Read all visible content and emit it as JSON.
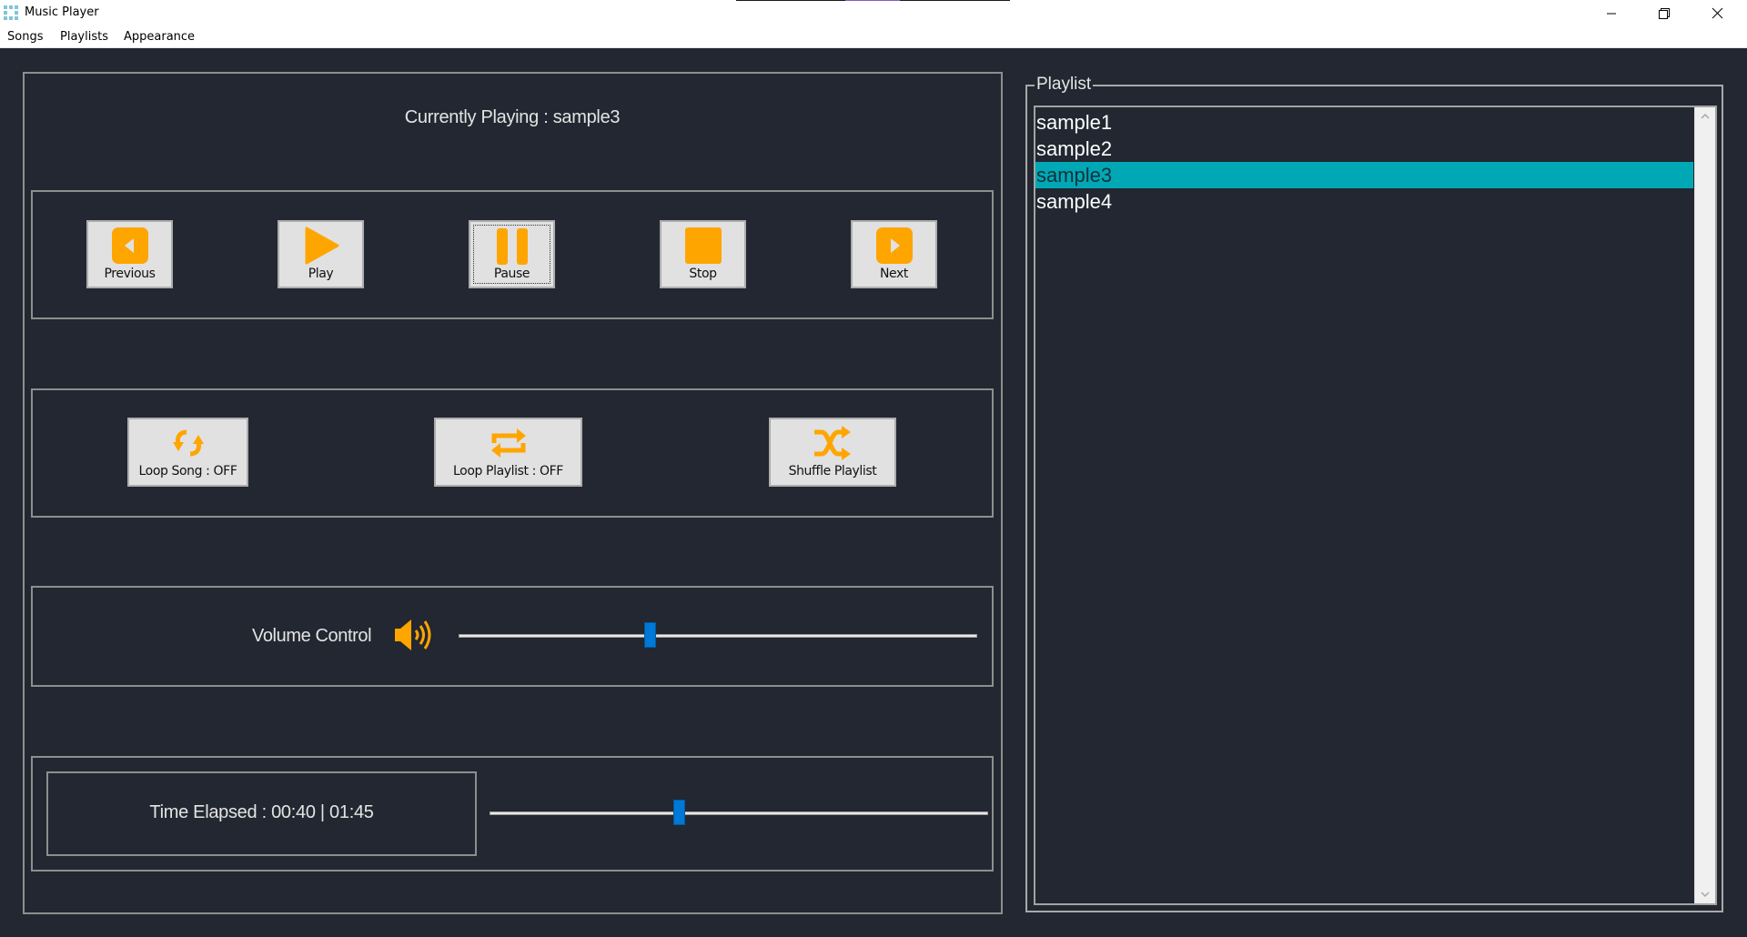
{
  "window": {
    "title": "Music Player",
    "icon": "app-grid-icon",
    "controls": [
      "minimize-icon",
      "restore-icon",
      "close-icon"
    ]
  },
  "menu": {
    "items": [
      "Songs",
      "Playlists",
      "Appearance"
    ]
  },
  "now_playing": {
    "text": "Currently Playing : sample3",
    "song": "sample3"
  },
  "controls": {
    "previous": {
      "label": "Previous",
      "icon": "previous-icon"
    },
    "play": {
      "label": "Play",
      "icon": "play-icon"
    },
    "pause": {
      "label": "Pause",
      "icon": "pause-icon",
      "focused": true
    },
    "stop": {
      "label": "Stop",
      "icon": "stop-icon"
    },
    "next": {
      "label": "Next",
      "icon": "next-icon"
    }
  },
  "modes": {
    "loop_song": {
      "label": "Loop Song : OFF",
      "icon": "loop-song-icon"
    },
    "loop_playlist": {
      "label": "Loop Playlist : OFF",
      "icon": "loop-playlist-icon"
    },
    "shuffle": {
      "label": "Shuffle Playlist",
      "icon": "shuffle-icon"
    }
  },
  "volume": {
    "label": "Volume Control",
    "icon": "speaker-icon",
    "level_percent": 37
  },
  "time": {
    "text": "Time Elapsed : 00:40 | 01:45",
    "elapsed": "00:40",
    "total": "01:45",
    "progress_fraction": 0.381
  },
  "playlist": {
    "title": "Playlist",
    "items": [
      "sample1",
      "sample2",
      "sample3",
      "sample4"
    ],
    "selected_index": 2
  },
  "colors": {
    "background": "#222731",
    "accent_icon": "#ffa500",
    "slider_thumb": "#0078d7",
    "selection": "#00a8b5"
  }
}
